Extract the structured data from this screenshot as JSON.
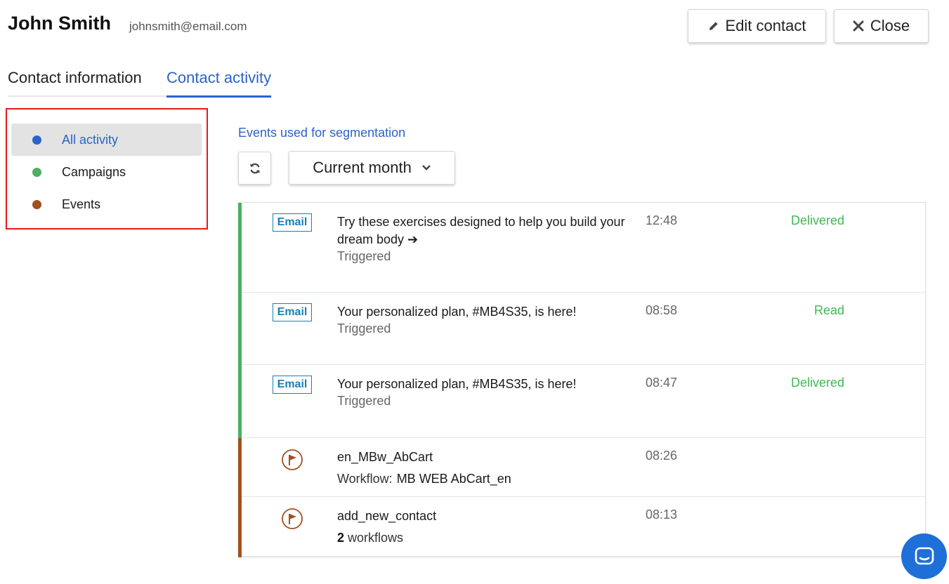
{
  "contact": {
    "name": "John Smith",
    "email": "johnsmith@email.com"
  },
  "header": {
    "edit_label": "Edit contact",
    "close_label": "Close",
    "edit_icon": "pencil-icon",
    "close_icon": "x-icon"
  },
  "tabs": [
    {
      "label": "Contact information",
      "active": false
    },
    {
      "label": "Contact activity",
      "active": true
    }
  ],
  "filters": [
    {
      "label": "All activity",
      "color": "#2b63c9",
      "active": true
    },
    {
      "label": "Campaigns",
      "color": "#4caf63",
      "active": false
    },
    {
      "label": "Events",
      "color": "#a0511f",
      "active": false
    }
  ],
  "segmentation_link": "Events used for segmentation",
  "period": {
    "selected": "Current month",
    "refresh_icon": "refresh-icon",
    "chevron_icon": "chevron-down-icon"
  },
  "activities": [
    {
      "kind": "campaign",
      "badge": "Email",
      "title": "Try these exercises designed to help you build your dream body ➔",
      "sub": "Triggered",
      "time": "12:48",
      "status": "Delivered"
    },
    {
      "kind": "campaign",
      "badge": "Email",
      "title": "Your personalized plan, #MB4S35, is here!",
      "sub": "Triggered",
      "time": "08:58",
      "status": "Read"
    },
    {
      "kind": "campaign",
      "badge": "Email",
      "title": "Your personalized plan, #MB4S35, is here!",
      "sub": "Triggered",
      "time": "08:47",
      "status": "Delivered"
    },
    {
      "kind": "event",
      "icon": "flag-icon",
      "title": "en_MBw_AbCart",
      "workflow_label": "Workflow:",
      "workflow_value": "MB WEB AbCart_en",
      "time": "08:26"
    },
    {
      "kind": "event",
      "icon": "flag-icon",
      "title": "add_new_contact",
      "workflow_count": "2",
      "workflow_count_label": "workflows",
      "time": "08:13"
    }
  ],
  "colors": {
    "campaign_bar": "#4caf63",
    "event_bar": "#a0511f",
    "accent": "#2b63c9",
    "status_green": "#3dba52"
  },
  "chat_icon": "chat-icon"
}
